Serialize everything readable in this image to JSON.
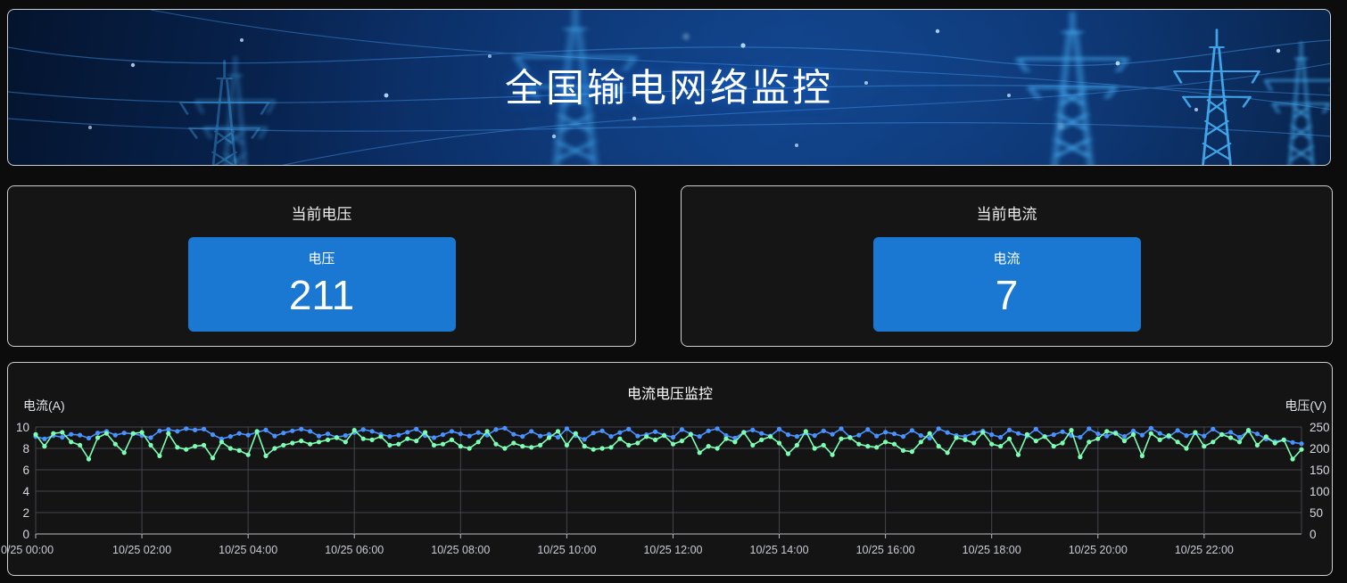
{
  "banner": {
    "title": "全国输电网络监控"
  },
  "stat_cards": [
    {
      "title": "当前电压",
      "gauge": {
        "label": "电压",
        "value": "211"
      }
    },
    {
      "title": "当前电流",
      "gauge": {
        "label": "电流",
        "value": "7"
      }
    }
  ],
  "chart_card": {
    "title": "电流电压监控"
  },
  "colors": {
    "gauge_blue": "#1b78d2",
    "card_border": "#cfcfcf",
    "series_current_green": "#7cffb2",
    "series_voltage_blue": "#4992ff",
    "grid_line": "#45454d",
    "axis_line": "#b9bcc4",
    "tick_text": "#d6d9e0"
  },
  "chart_data": {
    "type": "line",
    "title": "电流电压监控",
    "grid": true,
    "legend": false,
    "x_tick_labels": [
      "0/25 00:00",
      "10/25 02:00",
      "10/25 04:00",
      "10/25 06:00",
      "10/25 08:00",
      "10/25 10:00",
      "10/25 12:00",
      "10/25 14:00",
      "10/25 16:00",
      "10/25 18:00",
      "10/25 20:00",
      "10/25 22:00"
    ],
    "left_axis": {
      "name": "电流(A)",
      "min": 0,
      "max": 10,
      "ticks": [
        0,
        2,
        4,
        6,
        8,
        10
      ]
    },
    "right_axis": {
      "name": "电压(V)",
      "min": 0,
      "max": 250,
      "ticks": [
        0,
        50,
        100,
        150,
        200,
        250
      ]
    },
    "series": [
      {
        "name": "电压",
        "axis": "right",
        "color": "#4992ff",
        "values": [
          228,
          222,
          230,
          226,
          233,
          231,
          224,
          236,
          240,
          231,
          236,
          234,
          230,
          225,
          241,
          244,
          240,
          246,
          243,
          245,
          232,
          222,
          228,
          235,
          231,
          238,
          243,
          229,
          236,
          241,
          245,
          240,
          229,
          234,
          226,
          230,
          237,
          244,
          240,
          233,
          228,
          231,
          238,
          245,
          230,
          225,
          232,
          240,
          234,
          229,
          237,
          231,
          244,
          247,
          233,
          228,
          240,
          229,
          233,
          226,
          246,
          230,
          221,
          236,
          241,
          228,
          237,
          245,
          229,
          232,
          239,
          231,
          226,
          244,
          234,
          228,
          241,
          246,
          230,
          224,
          238,
          243,
          235,
          229,
          245,
          232,
          228,
          236,
          230,
          241,
          233,
          246,
          226,
          231,
          244,
          229,
          238,
          234,
          228,
          242,
          230,
          224,
          246,
          237,
          230,
          228,
          236,
          241,
          232,
          226,
          243,
          235,
          229,
          245,
          228,
          232,
          239,
          230,
          226,
          246,
          234,
          229,
          237,
          228,
          241,
          231,
          247,
          235,
          227,
          242,
          230,
          236,
          229,
          245,
          232,
          238,
          226,
          241,
          234,
          222,
          216,
          220,
          214,
          211
        ]
      },
      {
        "name": "电流",
        "axis": "left",
        "color": "#7cffb2",
        "values": [
          9.3,
          8.2,
          9.4,
          9.5,
          8.6,
          8.3,
          7.0,
          9.0,
          9.4,
          8.4,
          7.6,
          9.4,
          9.5,
          8.3,
          7.3,
          9.4,
          8.1,
          7.9,
          8.2,
          8.3,
          7.1,
          8.6,
          8.0,
          7.8,
          7.4,
          9.6,
          7.3,
          8.0,
          8.3,
          8.5,
          8.7,
          8.4,
          8.6,
          8.8,
          9.0,
          8.6,
          9.7,
          8.9,
          8.8,
          9.1,
          8.3,
          8.4,
          8.9,
          8.7,
          9.5,
          8.3,
          8.4,
          8.8,
          8.2,
          8.0,
          8.6,
          9.6,
          8.4,
          8.0,
          8.5,
          8.2,
          8.1,
          8.3,
          9.0,
          9.6,
          8.3,
          9.4,
          8.2,
          7.9,
          8.0,
          8.1,
          8.9,
          8.3,
          8.5,
          9.1,
          8.8,
          9.2,
          8.4,
          8.7,
          9.3,
          7.6,
          8.2,
          8.0,
          8.9,
          8.6,
          9.5,
          8.3,
          8.8,
          9.1,
          8.5,
          7.5,
          8.3,
          9.6,
          8.0,
          8.3,
          7.4,
          8.9,
          9.0,
          8.4,
          8.2,
          8.1,
          8.6,
          8.4,
          7.8,
          7.7,
          8.6,
          9.4,
          8.2,
          7.6,
          9.0,
          8.8,
          8.5,
          9.5,
          8.4,
          8.2,
          8.9,
          7.4,
          9.3,
          8.7,
          9.1,
          8.2,
          8.5,
          9.7,
          7.2,
          8.6,
          8.9,
          9.6,
          9.4,
          8.7,
          9.3,
          7.3,
          9.4,
          8.8,
          9.2,
          8.6,
          8.0,
          9.5,
          8.2,
          8.6,
          9.3,
          9.0,
          8.6,
          9.7,
          8.3,
          9.1,
          8.5,
          8.8,
          7.0,
          7.9
        ]
      }
    ]
  }
}
